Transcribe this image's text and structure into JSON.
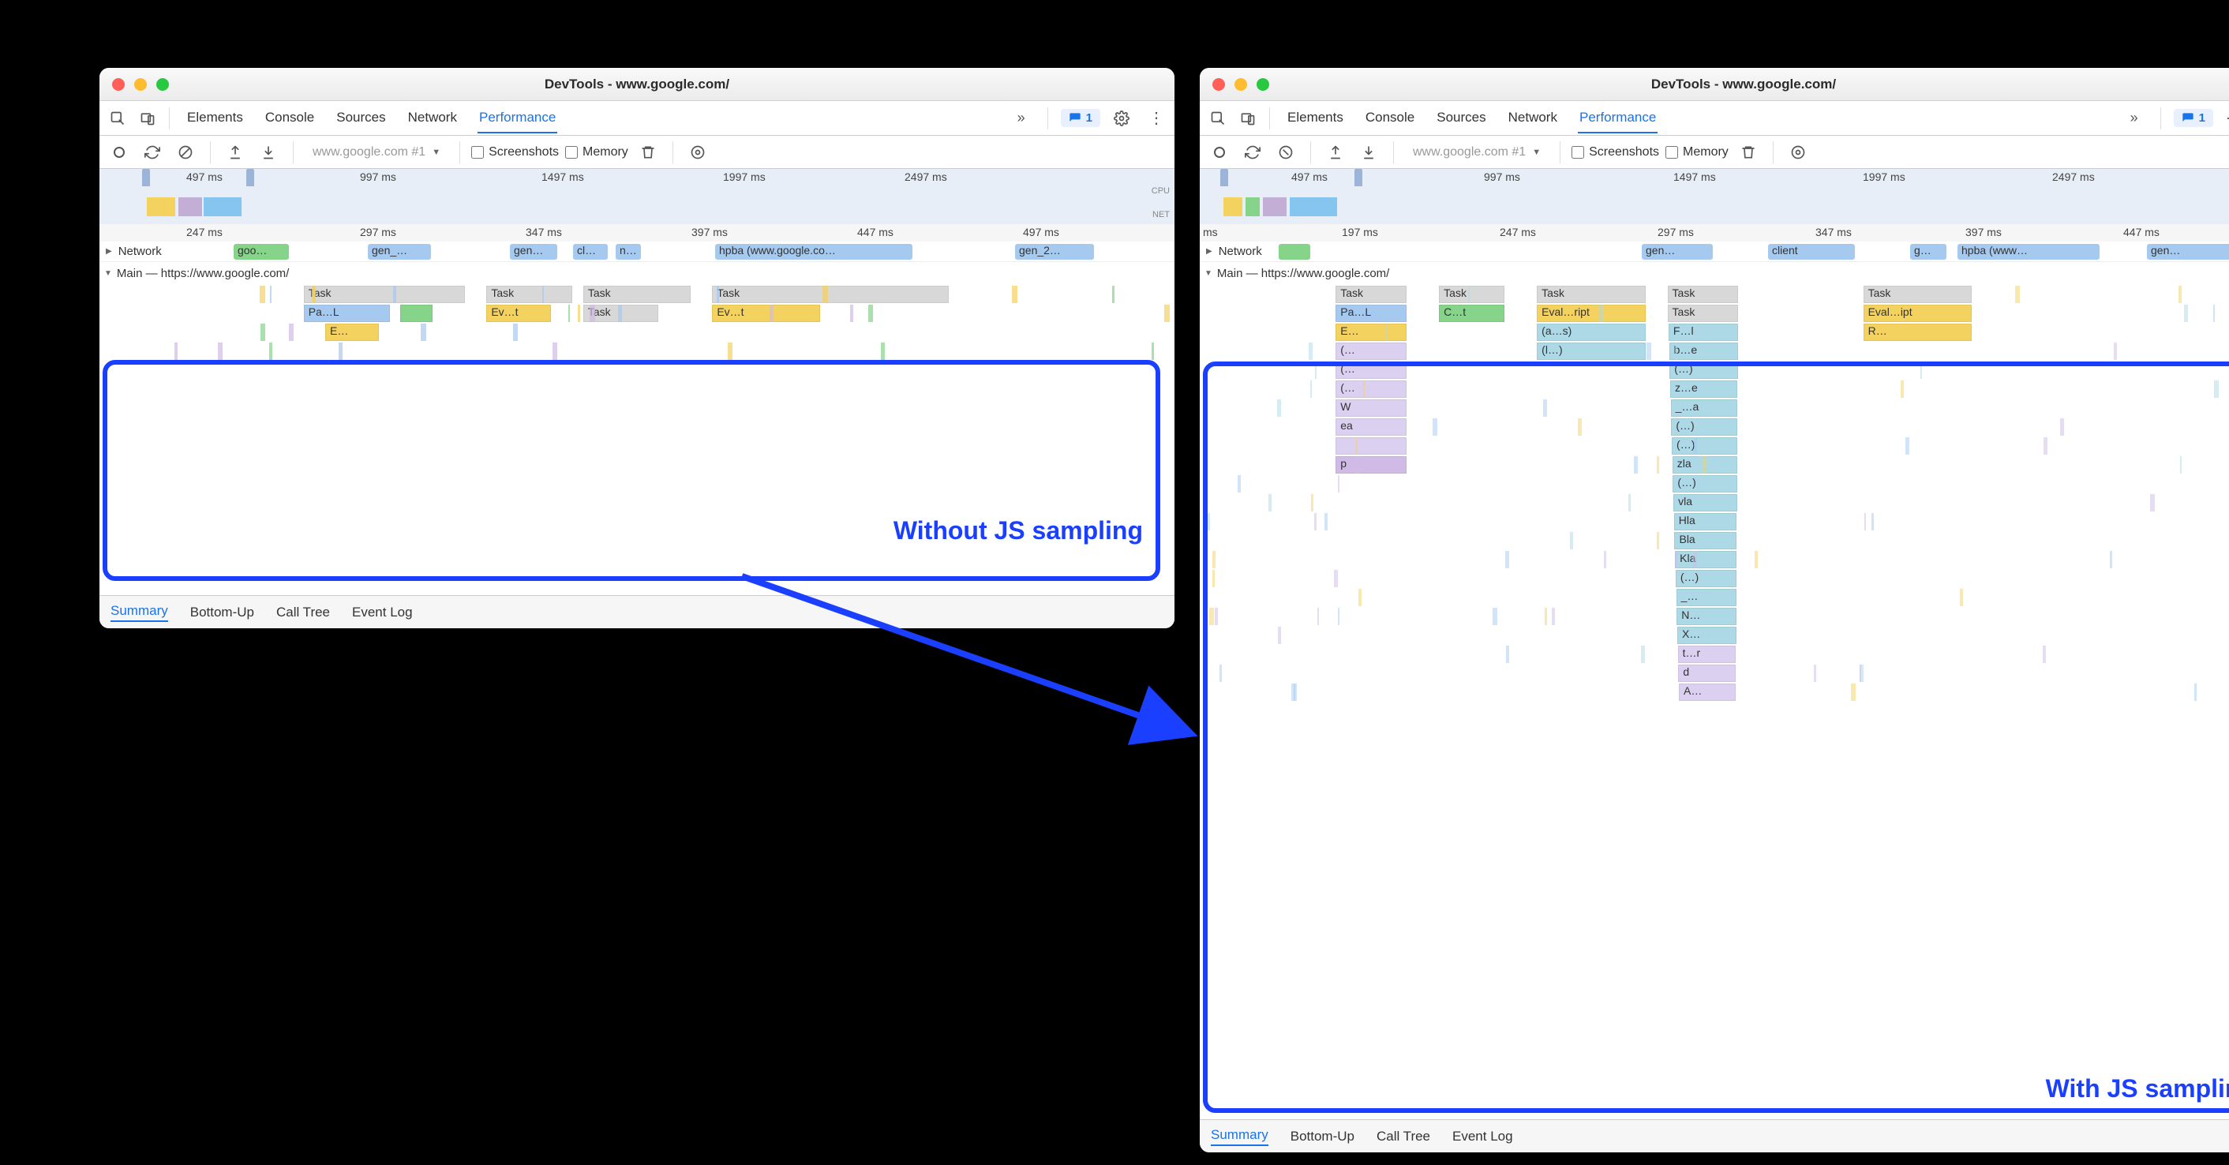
{
  "window_title": "DevTools - www.google.com/",
  "panels": [
    "Elements",
    "Console",
    "Sources",
    "Network",
    "Performance"
  ],
  "active_panel": "Performance",
  "issues_count": "1",
  "recording_selector": "www.google.com #1",
  "checkboxes": {
    "screenshots": "Screenshots",
    "memory": "Memory"
  },
  "overview_ticks": [
    "497 ms",
    "997 ms",
    "1497 ms",
    "1997 ms",
    "2497 ms"
  ],
  "overview_labels": {
    "cpu": "CPU",
    "net": "NET"
  },
  "detail_ticks_left": [
    "247 ms",
    "297 ms",
    "347 ms",
    "397 ms",
    "447 ms",
    "497 ms"
  ],
  "detail_ticks_right": [
    "ms",
    "197 ms",
    "247 ms",
    "297 ms",
    "347 ms",
    "397 ms",
    "447 ms"
  ],
  "network_label": "Network",
  "network_items_left": [
    "goo…",
    "gen_…",
    "gen…",
    "cl…",
    "n…",
    "hpba (www.google.co…",
    "gen_2…"
  ],
  "network_items_right": [
    "gen…",
    "client",
    "g…",
    "hpba (www…",
    "gen…"
  ],
  "main_label_left": "Main — https://www.google.com/",
  "main_label_right": "Main — https://www.google.com/",
  "flame_left": {
    "row0": [
      {
        "x": 19,
        "w": 15,
        "c": "c-task",
        "t": "Task"
      },
      {
        "x": 36,
        "w": 8,
        "c": "c-task",
        "t": "Task"
      },
      {
        "x": 45,
        "w": 10,
        "c": "c-task",
        "t": "Task"
      },
      {
        "x": 57,
        "w": 22,
        "c": "c-task",
        "t": "Task"
      }
    ],
    "row1": [
      {
        "x": 19,
        "w": 8,
        "c": "c-blue",
        "t": "Pa…L"
      },
      {
        "x": 28,
        "w": 3,
        "c": "c-green",
        "t": ""
      },
      {
        "x": 36,
        "w": 6,
        "c": "c-yellow",
        "t": "Ev…t"
      },
      {
        "x": 45,
        "w": 7,
        "c": "c-task",
        "t": "Task"
      },
      {
        "x": 57,
        "w": 10,
        "c": "c-yellow",
        "t": "Ev…t"
      }
    ],
    "row2": [
      {
        "x": 21,
        "w": 5,
        "c": "c-yellow",
        "t": "E…"
      }
    ]
  },
  "flame_right_cols": {
    "col1": {
      "x": 12.5,
      "w": 6.5,
      "rows": [
        {
          "c": "c-task",
          "t": "Task"
        },
        {
          "c": "c-blue",
          "t": "Pa…L"
        },
        {
          "c": "c-yellow",
          "t": "E…"
        },
        {
          "c": "c-lav",
          "t": "(…"
        },
        {
          "c": "c-lav",
          "t": "(…"
        },
        {
          "c": "c-lav",
          "t": "(…"
        },
        {
          "c": "c-lav",
          "t": "W"
        },
        {
          "c": "c-lav",
          "t": "ea"
        },
        {
          "c": "c-lav",
          "t": ""
        },
        {
          "c": "c-purple",
          "t": "p"
        }
      ]
    },
    "col2": {
      "x": 22,
      "w": 6,
      "rows": [
        {
          "c": "c-task",
          "t": "Task"
        },
        {
          "c": "c-green",
          "t": "C…t"
        }
      ]
    },
    "col3": {
      "x": 31,
      "w": 10,
      "rows": [
        {
          "c": "c-task",
          "t": "Task"
        },
        {
          "c": "c-yellow",
          "t": "Eval…ript"
        },
        {
          "c": "c-teal",
          "t": "(a…s)"
        },
        {
          "c": "c-teal",
          "t": "(l…)"
        }
      ]
    },
    "col4": {
      "x": 43,
      "w": 6.5,
      "rows": [
        {
          "c": "c-task",
          "t": "Task"
        },
        {
          "c": "c-task",
          "t": "Task"
        },
        {
          "c": "c-teal",
          "t": "F…l"
        },
        {
          "c": "c-teal",
          "t": "b…e"
        },
        {
          "c": "c-teal",
          "t": "(…)"
        },
        {
          "c": "c-teal",
          "t": "z…e"
        },
        {
          "c": "c-teal",
          "t": "_…a"
        },
        {
          "c": "c-teal",
          "t": "(…)"
        },
        {
          "c": "c-teal",
          "t": "(…)"
        },
        {
          "c": "c-teal",
          "t": "zla"
        },
        {
          "c": "c-teal",
          "t": "(…)"
        },
        {
          "c": "c-teal",
          "t": "vla"
        },
        {
          "c": "c-teal",
          "t": "Hla"
        },
        {
          "c": "c-teal",
          "t": "Bla"
        },
        {
          "c": "c-teal",
          "t": "Kla"
        },
        {
          "c": "c-teal",
          "t": "(…)"
        },
        {
          "c": "c-teal",
          "t": "_…"
        },
        {
          "c": "c-teal",
          "t": "N…"
        },
        {
          "c": "c-teal",
          "t": "X…"
        },
        {
          "c": "c-lav",
          "t": "t…r"
        },
        {
          "c": "c-lav",
          "t": "d"
        },
        {
          "c": "c-lav",
          "t": "A…"
        }
      ]
    },
    "col5": {
      "x": 61,
      "w": 10,
      "rows": [
        {
          "c": "c-task",
          "t": "Task"
        },
        {
          "c": "c-yellow",
          "t": "Eval…ipt"
        },
        {
          "c": "c-yellow",
          "t": "R…"
        }
      ]
    }
  },
  "bottom_tabs": [
    "Summary",
    "Bottom-Up",
    "Call Tree",
    "Event Log"
  ],
  "active_bottom_tab": "Summary",
  "annotation_left": "Without JS sampling",
  "annotation_right": "With JS sampling"
}
